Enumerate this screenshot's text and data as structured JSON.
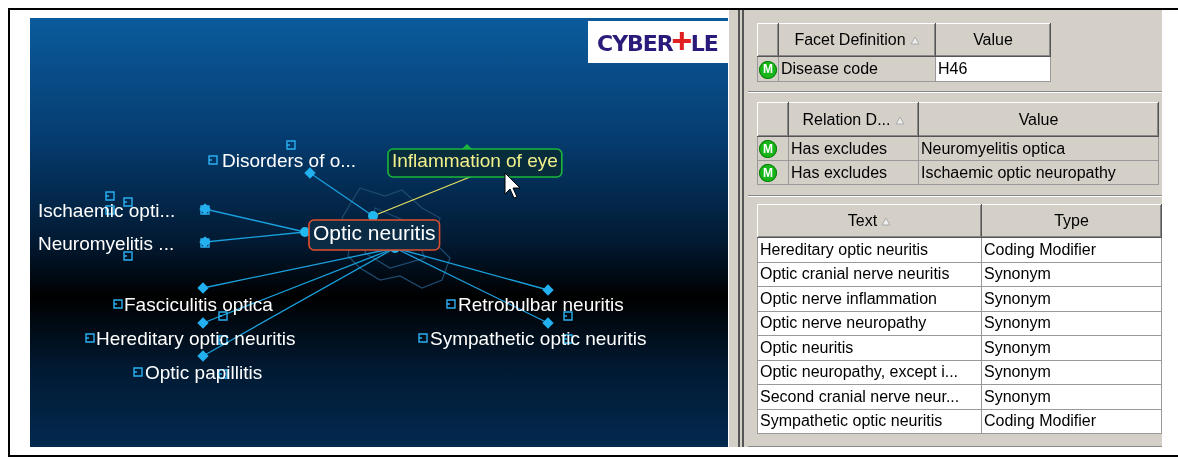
{
  "graph": {
    "logo": {
      "text_before": "CYBER",
      "text_after": "LE"
    },
    "nodes": [
      {
        "label": "Disorders of o...",
        "kind": "plain"
      },
      {
        "label": "Inflammation of eye",
        "kind": "highlight"
      },
      {
        "label": "Ischaemic opti...",
        "kind": "plain"
      },
      {
        "label": "Neuromyelitis ...",
        "kind": "plain"
      },
      {
        "label": "Optic neuritis",
        "kind": "focus"
      },
      {
        "label": "Fasciculitis optica",
        "kind": "plain"
      },
      {
        "label": "Hereditary optic neuritis",
        "kind": "plain"
      },
      {
        "label": "Optic papillitis",
        "kind": "plain"
      },
      {
        "label": "Retrobulbar neuritis",
        "kind": "plain"
      },
      {
        "label": "Sympathetic optic neuritis",
        "kind": "plain"
      }
    ]
  },
  "facets": {
    "columns": [
      {
        "label": "Facet Definition",
        "sorted": true
      },
      {
        "label": "Value",
        "sorted": false
      }
    ],
    "rows": [
      {
        "marker": "M",
        "cells": [
          "Disease code",
          "H46"
        ]
      }
    ]
  },
  "relations": {
    "columns": [
      {
        "label": "Relation D...",
        "sorted": true
      },
      {
        "label": "Value",
        "sorted": false
      }
    ],
    "rows": [
      {
        "marker": "M",
        "cells": [
          "Has excludes",
          "Neuromyelitis optica"
        ]
      },
      {
        "marker": "M",
        "cells": [
          "Has excludes",
          "Ischaemic optic neuropathy"
        ]
      }
    ]
  },
  "texts": {
    "columns": [
      {
        "label": "Text",
        "sorted": true
      },
      {
        "label": "Type",
        "sorted": false
      }
    ],
    "rows": [
      {
        "cells": [
          "Hereditary optic neuritis",
          "Coding Modifier"
        ]
      },
      {
        "cells": [
          "Optic cranial nerve neuritis",
          "Synonym"
        ]
      },
      {
        "cells": [
          "Optic nerve inflammation",
          "Synonym"
        ]
      },
      {
        "cells": [
          "Optic nerve neuropathy",
          "Synonym"
        ]
      },
      {
        "cells": [
          "Optic neuritis",
          "Synonym"
        ]
      },
      {
        "cells": [
          "Optic neuropathy, except i...",
          "Synonym"
        ]
      },
      {
        "cells": [
          "Second cranial nerve neur...",
          "Synonym"
        ]
      },
      {
        "cells": [
          "Sympathetic optic neuritis",
          "Coding Modifier"
        ]
      }
    ]
  }
}
